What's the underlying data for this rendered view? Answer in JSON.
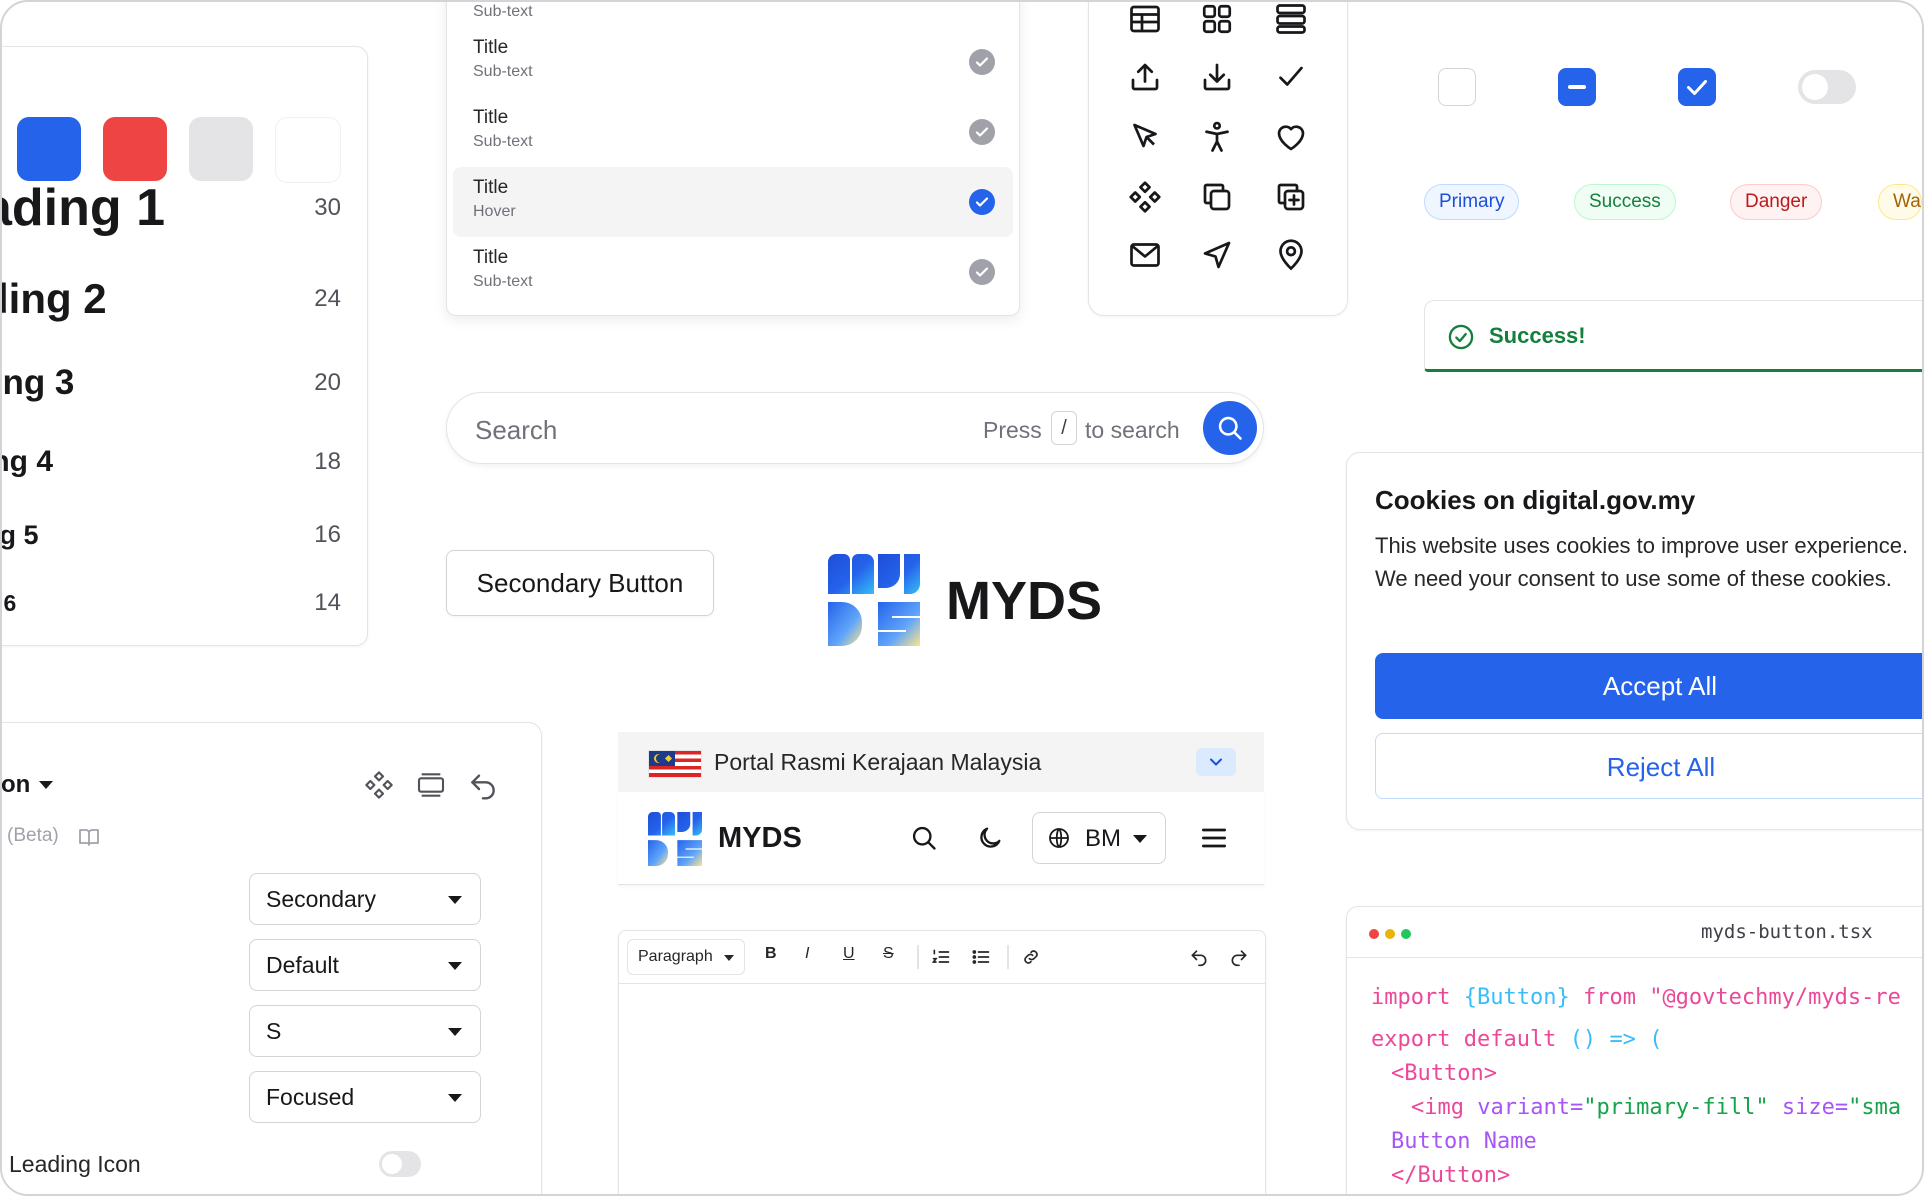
{
  "colors": {
    "primary": "#2563eb",
    "danger": "#ef4444",
    "success": "#15803d",
    "gray": "#e4e4e7"
  },
  "typography": {
    "headings": [
      {
        "label": "ading 1",
        "size": "30"
      },
      {
        "label": "ding 2",
        "size": "24"
      },
      {
        "label": "ling 3",
        "size": "20"
      },
      {
        "label": "ing 4",
        "size": "18"
      },
      {
        "label": "ng 5",
        "size": "16"
      },
      {
        "label": "g 6",
        "size": "14"
      }
    ]
  },
  "dropdown": {
    "top_partial": "Sub-text",
    "items": [
      {
        "title": "Title",
        "sub": "Sub-text"
      },
      {
        "title": "Title",
        "sub": "Sub-text"
      },
      {
        "title": "Title",
        "sub": "Hover"
      },
      {
        "title": "Title",
        "sub": "Sub-text"
      }
    ]
  },
  "icons": [
    "table-icon",
    "grid-icon",
    "list-icon",
    "upload-icon",
    "download-icon",
    "check-icon",
    "cursor-icon",
    "accessibility-icon",
    "heart-icon",
    "component-icon",
    "copy-icon",
    "add-copy-icon",
    "mail-icon",
    "send-icon",
    "location-icon"
  ],
  "tags": {
    "primary": "Primary",
    "success": "Success",
    "danger": "Danger",
    "warning": "Wa"
  },
  "toast": {
    "text": "Success!"
  },
  "search": {
    "placeholder": "Search",
    "hint_press": "Press",
    "hint_key": "/",
    "hint_to": "to search"
  },
  "buttons": {
    "secondary": "Secondary Button"
  },
  "logo": {
    "text": "MYDS"
  },
  "cookie": {
    "title": "Cookies on digital.gov.my",
    "body": "This website uses cookies to improve user experience. We need your consent to use some of these cookies.",
    "accept": "Accept All",
    "reject": "Reject All"
  },
  "config_panel": {
    "title_partial": "on",
    "beta": "(Beta)",
    "selects": [
      "Secondary",
      "Default",
      "S",
      "Focused"
    ],
    "leading_icon": "Leading Icon"
  },
  "masthead": {
    "text": "Portal Rasmi Kerajaan Malaysia",
    "brand": "MYDS",
    "lang": "BM"
  },
  "editor": {
    "paragraph": "Paragraph",
    "bold": "B",
    "italic": "I",
    "underline": "U",
    "strike": "S"
  },
  "code": {
    "filename": "myds-button.tsx",
    "l1a": "import",
    "l1b": "{Button}",
    "l1c": "from",
    "l1d": "\"@govtechmy/myds-re",
    "l2a": "export default",
    "l2b": "()",
    "l2c": "=>",
    "l2d": "(",
    "l3": "<Button>",
    "l4a": "<img",
    "l4b": "variant=",
    "l4c": "\"primary-fill\"",
    "l4d": "size=",
    "l4e": "\"sma",
    "l5": "Button Name",
    "l6": "</Button>"
  }
}
